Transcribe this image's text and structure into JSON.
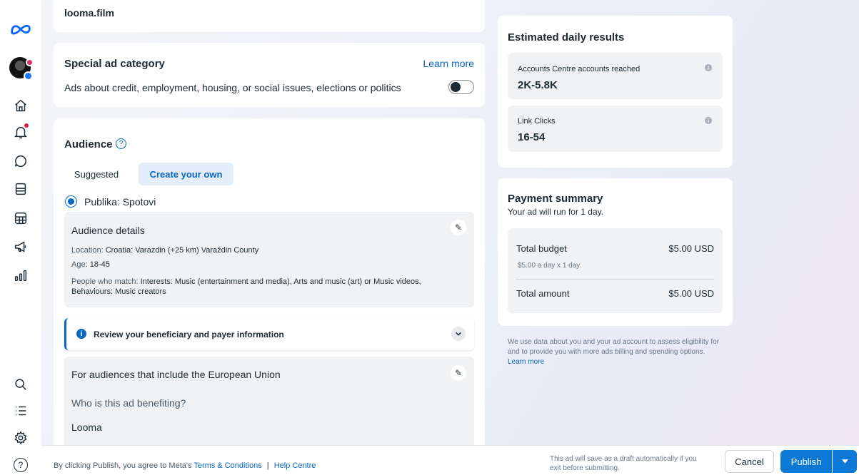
{
  "sidebar": {
    "logo_icon": "meta-logo-icon",
    "items": [
      {
        "icon": "home-icon"
      },
      {
        "icon": "bell-icon"
      },
      {
        "icon": "chat-icon"
      },
      {
        "icon": "pages-icon"
      },
      {
        "icon": "table-icon"
      },
      {
        "icon": "megaphone-icon"
      },
      {
        "icon": "chart-icon"
      }
    ],
    "bottom_items": [
      {
        "icon": "search-icon"
      },
      {
        "icon": "list-icon"
      },
      {
        "icon": "gear-icon"
      },
      {
        "icon": "help-icon",
        "glyph": "?"
      }
    ]
  },
  "website_card": {
    "url": "looma.film"
  },
  "special_ad": {
    "title": "Special ad category",
    "learn_more": "Learn more",
    "description": "Ads about credit, employment, housing, or social issues, elections or politics",
    "toggle_on": false
  },
  "audience": {
    "title": "Audience",
    "help_icon": "question-circle-icon",
    "tabs": [
      "Suggested",
      "Create your own"
    ],
    "active_tab": 1,
    "selected_audience": "Publika: Spotovi",
    "details": {
      "title": "Audience details",
      "location_label": "Location: ",
      "location_value": "Croatia: Varazdin (+25 km) Varaždin County",
      "age_label": "Age: ",
      "age_value": "18-45",
      "people_label": "People who match: ",
      "people_value": "Interests: Music (entertainment and media), Arts and music (art) or Music videos, Behaviours: Music creators"
    },
    "review_banner": "Review your beneficiary and payer information",
    "eu": {
      "title": "For audiences that include the European Union",
      "question": "Who is this ad benefiting?",
      "answer": "Looma"
    }
  },
  "estimated": {
    "title": "Estimated daily results",
    "metrics": [
      {
        "label": "Accounts Centre accounts reached",
        "value": "2K-5.8K"
      },
      {
        "label": "Link Clicks",
        "value": "16-54"
      }
    ]
  },
  "payment": {
    "title": "Payment summary",
    "subtitle": "Your ad will run for 1 day.",
    "total_budget_label": "Total budget",
    "total_budget_value": "$5.00 USD",
    "budget_note": "$5.00 a day x 1 day.",
    "total_amount_label": "Total amount",
    "total_amount_value": "$5.00 USD",
    "disclaimer": "We use data about you and your ad account to assess eligibility for and to provide you with more ads billing and spending options.",
    "disclaimer_link": "Learn more"
  },
  "footer": {
    "agree_text": "By clicking Publish, you agree to Meta's ",
    "terms_link": "Terms & Conditions",
    "separator": "|",
    "help_link": "Help Centre",
    "draft_note": "This ad will save as a draft automatically if you exit before submitting.",
    "cancel_label": "Cancel",
    "publish_label": "Publish"
  },
  "colors": {
    "accent": "#0a66c2",
    "publish": "#0a78d4",
    "text": "#1c2b33"
  }
}
